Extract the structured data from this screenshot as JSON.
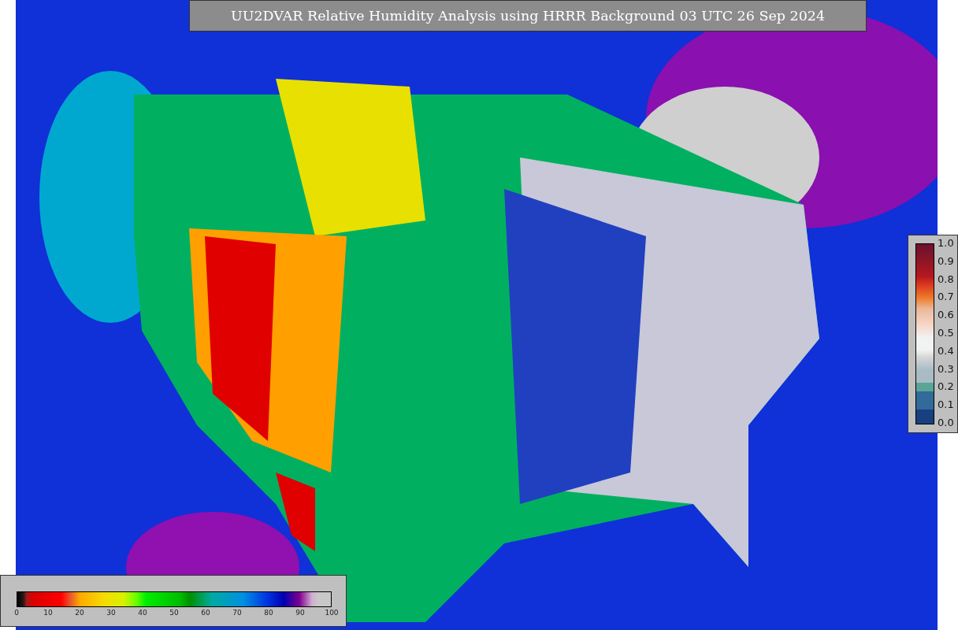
{
  "title": "UU2DVAR Relative Humidity Analysis using HRRR Background 03 UTC 26 Sep 2024",
  "weight_legend": {
    "ticks": [
      "1.0",
      "0.9",
      "0.8",
      "0.7",
      "0.6",
      "0.5",
      "0.4",
      "0.3",
      "0.2",
      "0.1",
      "0.0"
    ]
  },
  "humidity_legend": {
    "ticks": [
      "0",
      "10",
      "20",
      "30",
      "40",
      "50",
      "60",
      "70",
      "80",
      "90",
      "100"
    ]
  }
}
